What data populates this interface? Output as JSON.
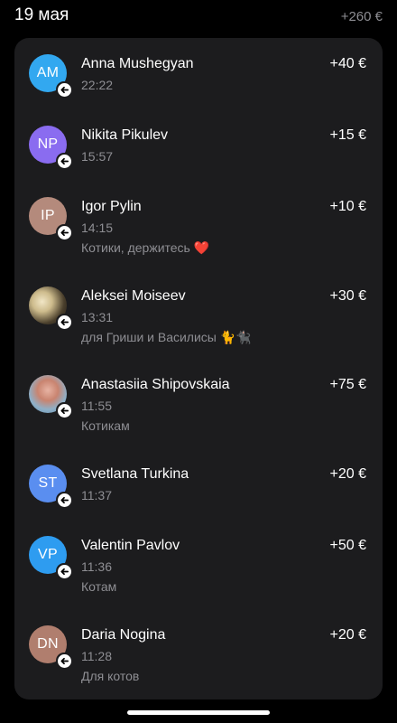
{
  "header": {
    "date": "19 мая",
    "total": "+260 €"
  },
  "transfers": [
    {
      "initials": "AM",
      "avatar_color": "#32a8f0",
      "avatar_kind": "initials",
      "name": "Anna Mushegyan",
      "time": "22:22",
      "comment": "",
      "amount": "+40 €"
    },
    {
      "initials": "NP",
      "avatar_color": "#8a6cf0",
      "avatar_kind": "initials",
      "name": "Nikita Pikulev",
      "time": "15:57",
      "comment": "",
      "amount": "+15 €"
    },
    {
      "initials": "IP",
      "avatar_color": "#b48a7c",
      "avatar_kind": "initials",
      "name": "Igor Pylin",
      "time": "14:15",
      "comment": "Котики, держитесь ❤️",
      "amount": "+10 €"
    },
    {
      "initials": "",
      "avatar_color": "#4a3f2c",
      "avatar_kind": "photo-cat",
      "name": "Aleksei Moiseev",
      "time": "13:31",
      "comment": "для Гриши и Василисы 🐈🐈‍⬛",
      "amount": "+30 €"
    },
    {
      "initials": "",
      "avatar_color": "#c98470",
      "avatar_kind": "photo-person",
      "name": "Anastasiia Shipovskaia",
      "time": "11:55",
      "comment": "Котикам",
      "amount": "+75 €"
    },
    {
      "initials": "ST",
      "avatar_color": "#5a8ef0",
      "avatar_kind": "initials",
      "name": "Svetlana Turkina",
      "time": "11:37",
      "comment": "",
      "amount": "+20 €"
    },
    {
      "initials": "VP",
      "avatar_color": "#2e9cf0",
      "avatar_kind": "initials",
      "name": "Valentin Pavlov",
      "time": "11:36",
      "comment": "Котам",
      "amount": "+50 €"
    },
    {
      "initials": "DN",
      "avatar_color": "#b07e6e",
      "avatar_kind": "initials",
      "name": "Daria Nogina",
      "time": "11:28",
      "comment": "Для котов",
      "amount": "+20 €"
    }
  ],
  "icons": {
    "badge": "incoming-arrow-icon"
  }
}
